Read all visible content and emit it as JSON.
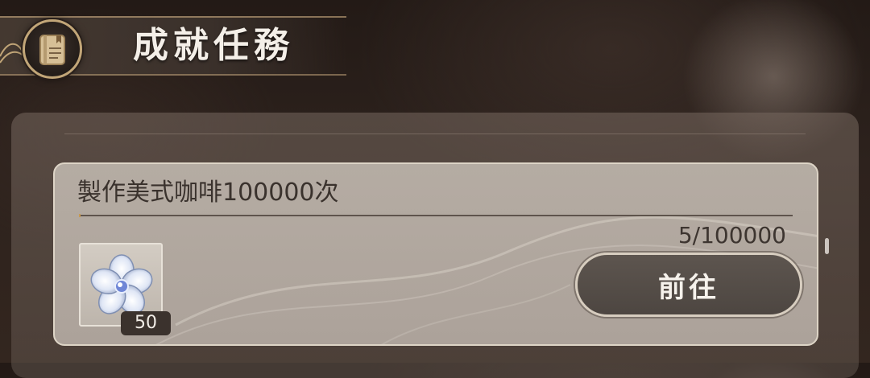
{
  "header": {
    "title": "成就任務",
    "icon": "notebook-icon"
  },
  "quest": {
    "title": "製作美式咖啡100000次",
    "progress_text": "5/100000",
    "progress_fraction": 5e-05,
    "reward": {
      "icon": "crystal-flower-icon",
      "quantity": "50"
    },
    "go_button_label": "前往"
  },
  "colors": {
    "accent_gold": "#c2a678",
    "button_fill": "#544c47",
    "card_fill": "#b0a79e"
  }
}
